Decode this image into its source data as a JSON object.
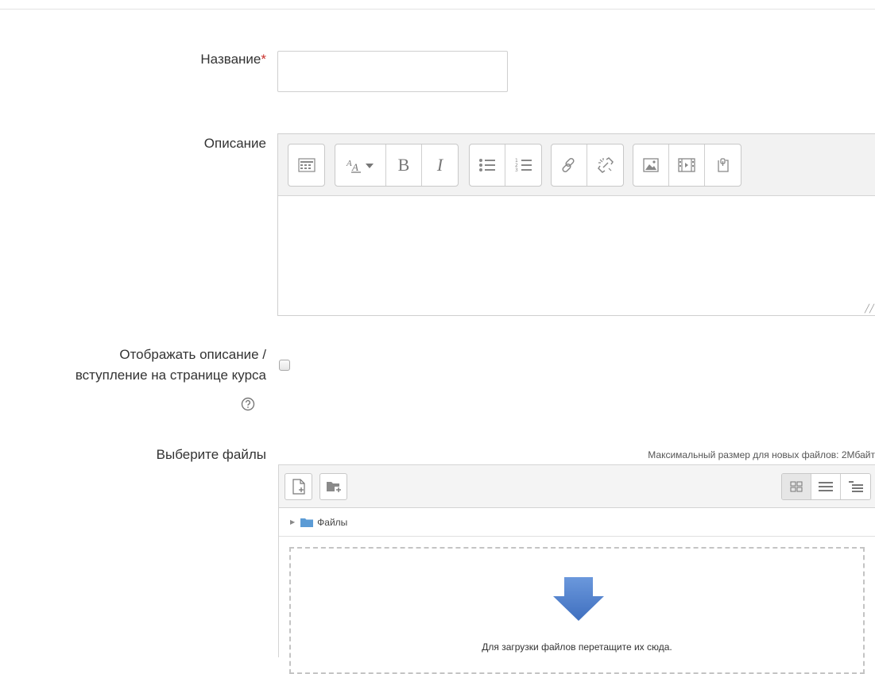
{
  "form": {
    "name_label": "Название",
    "required_mark": "*",
    "name_value": "",
    "description_label": "Описание",
    "description_value": "",
    "show_description_label_line1": "Отображать описание /",
    "show_description_label_line2": "вступление на странице курса",
    "show_description_checked": false,
    "files_label": "Выберите файлы"
  },
  "editor": {
    "toolbar": [
      [
        "show-more-buttons-icon"
      ],
      [
        "font-size-icon",
        "bold-icon",
        "italic-icon"
      ],
      [
        "unordered-list-icon",
        "ordered-list-icon"
      ],
      [
        "link-icon",
        "unlink-icon"
      ],
      [
        "image-icon",
        "media-icon",
        "manage-files-icon"
      ]
    ],
    "bold_glyph": "B",
    "italic_glyph": "I"
  },
  "filemanager": {
    "max_size_text": "Максимальный размер для новых файлов: 2Мбайт",
    "path_folder": "Файлы",
    "dropzone_text": "Для загрузки файлов перетащите их сюда.",
    "view_modes": [
      "icons",
      "list",
      "tree"
    ],
    "active_view": "icons"
  },
  "colors": {
    "required": "#c9302c",
    "drop_arrow": "#4a7cc7",
    "folder": "#5b9bd5"
  }
}
